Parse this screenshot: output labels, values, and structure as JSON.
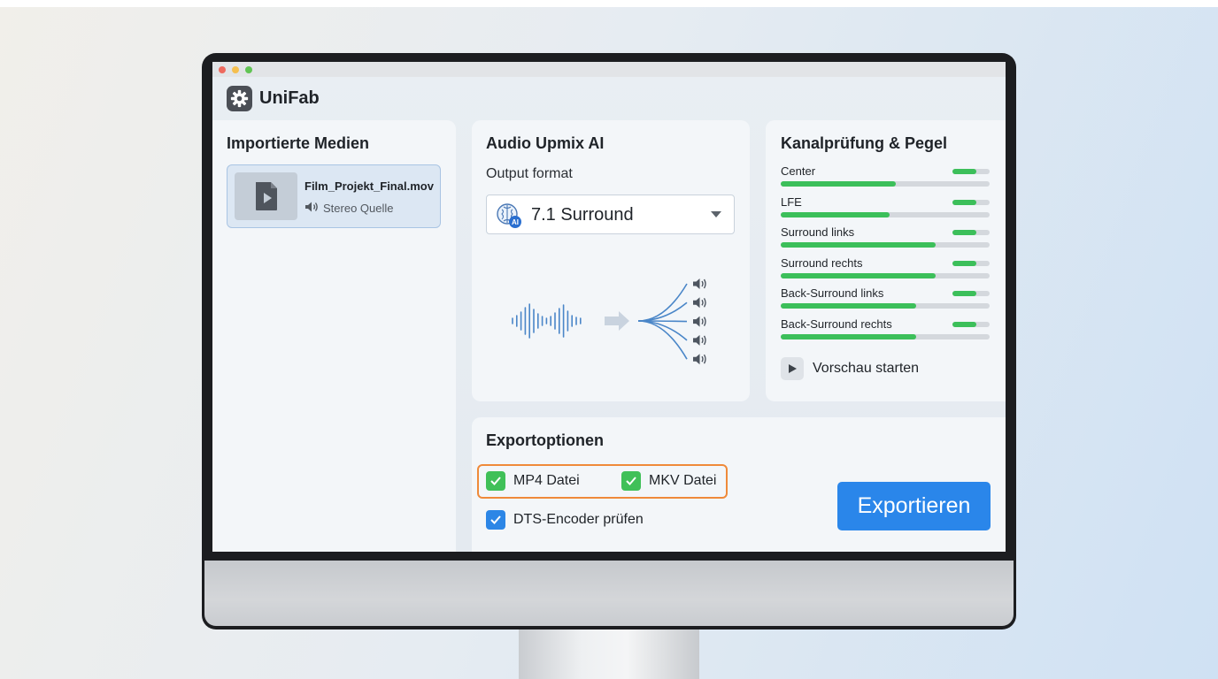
{
  "app": {
    "name": "UniFab",
    "icon": "gear-icon"
  },
  "window_controls": [
    {
      "name": "close",
      "color": "#ee6a5f"
    },
    {
      "name": "minimize",
      "color": "#f5bf4f"
    },
    {
      "name": "maximize",
      "color": "#61c454"
    }
  ],
  "media": {
    "title": "Importierte Medien",
    "items": [
      {
        "filename": "Film_Projekt_Final.mov",
        "subtitle": "Stereo Quelle",
        "icon": "video-file-icon",
        "sub_icon": "speaker-icon"
      }
    ]
  },
  "upmix": {
    "title": "Audio Upmix AI",
    "output_label": "Output format",
    "selected_format": "7.1 Surround",
    "select_icon": "ai-brain-icon",
    "visual": "waveform-to-speakers",
    "speaker_count": 5
  },
  "channels": {
    "title": "Kanalprüfung & Pegel",
    "level_color": "#3cbf5a",
    "items": [
      {
        "label": "Center",
        "level": 0.55,
        "peak": 0.65
      },
      {
        "label": "LFE",
        "level": 0.52,
        "peak": 0.65
      },
      {
        "label": "Surround links",
        "level": 0.74,
        "peak": 0.65
      },
      {
        "label": "Surround rechts",
        "level": 0.74,
        "peak": 0.65
      },
      {
        "label": "Back-Surround links",
        "level": 0.65,
        "peak": 0.65
      },
      {
        "label": "Back-Surround rechts",
        "level": 0.65,
        "peak": 0.65
      }
    ],
    "preview_label": "Vorschau starten",
    "preview_icon": "play-icon"
  },
  "export": {
    "title": "Exportoptionen",
    "options": [
      {
        "label": "MP4 Datei",
        "checked": true
      },
      {
        "label": "MKV Datei",
        "checked": true
      },
      {
        "label": "DTS-Encoder prüfen",
        "checked": true
      }
    ],
    "button_label": "Exportieren",
    "accent_color": "#2a86ea",
    "highlight_color": "#ef8a3a"
  }
}
